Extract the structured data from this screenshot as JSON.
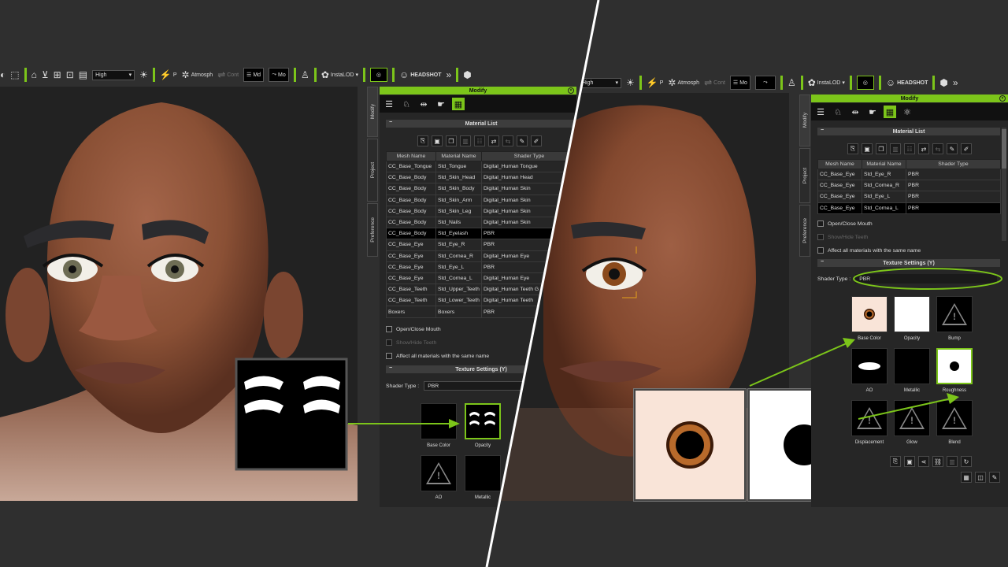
{
  "toolbar_left": {
    "render_quality": "High",
    "p_label": "P",
    "atmosphere_label": "Atmosph",
    "cont_label": "Cont",
    "md_label": "Md",
    "mo_label": "Mo",
    "instalod_label": "InstaLOD",
    "headshot_label": "HEADSHOT",
    "more": "»"
  },
  "toolbar_right": {
    "render_quality": "High",
    "p_label": "P",
    "atmosphere_label": "Atmosph",
    "cont_label": "Cont",
    "md_label": "Mo",
    "instalod_label": "InstaLOD",
    "headshot_label": "HEADSHOT",
    "more": "»"
  },
  "side_tabs": [
    "Modify",
    "Project",
    "Preference"
  ],
  "left_panel": {
    "title": "Modify",
    "material_list_title": "Material List",
    "columns": [
      "Mesh Name",
      "Material Name",
      "Shader Type"
    ],
    "rows": [
      [
        "CC_Base_Tongue",
        "Std_Tongue",
        "Digital_Human Tongue"
      ],
      [
        "CC_Base_Body",
        "Std_Skin_Head",
        "Digital_Human Head"
      ],
      [
        "CC_Base_Body",
        "Std_Skin_Body",
        "Digital_Human Skin"
      ],
      [
        "CC_Base_Body",
        "Std_Skin_Arm",
        "Digital_Human Skin"
      ],
      [
        "CC_Base_Body",
        "Std_Skin_Leg",
        "Digital_Human Skin"
      ],
      [
        "CC_Base_Body",
        "Std_Nails",
        "Digital_Human Skin"
      ],
      [
        "CC_Base_Body",
        "Std_Eyelash",
        "PBR"
      ],
      [
        "CC_Base_Eye",
        "Std_Eye_R",
        "PBR"
      ],
      [
        "CC_Base_Eye",
        "Std_Cornea_R",
        "Digital_Human Eye"
      ],
      [
        "CC_Base_Eye",
        "Std_Eye_L",
        "PBR"
      ],
      [
        "CC_Base_Eye",
        "Std_Cornea_L",
        "Digital_Human Eye"
      ],
      [
        "CC_Base_Teeth",
        "Std_Upper_Teeth",
        "Digital_Human Teeth G"
      ],
      [
        "CC_Base_Teeth",
        "Std_Lower_Teeth",
        "Digital_Human Teeth"
      ],
      [
        "Boxers",
        "Boxers",
        "PBR"
      ]
    ],
    "highlight_row": 6,
    "open_close_mouth": "Open/Close Mouth",
    "show_hide_teeth": "Show/Hide Teeth",
    "affect_all": "Affect all materials with the same name",
    "texture_settings_title": "Texture Settings  (Y)",
    "shader_type_label": "Shader Type :",
    "shader_type_value": "PBR",
    "textures": [
      "Base Color",
      "Opacity",
      "AO",
      "Metallic"
    ]
  },
  "right_panel": {
    "title": "Modify",
    "material_list_title": "Material List",
    "columns": [
      "Mesh Name",
      "Material Name",
      "Shader Type"
    ],
    "rows": [
      [
        "CC_Base_Eye",
        "Std_Eye_R",
        "PBR"
      ],
      [
        "CC_Base_Eye",
        "Std_Cornea_R",
        "PBR"
      ],
      [
        "CC_Base_Eye",
        "Std_Eye_L",
        "PBR"
      ],
      [
        "CC_Base_Eye",
        "Std_Cornea_L",
        "PBR"
      ]
    ],
    "highlight_row": 3,
    "open_close_mouth": "Open/Close Mouth",
    "show_hide_teeth": "Show/Hide Teeth",
    "affect_all": "Affect all materials with the same name",
    "texture_settings_title": "Texture Settings  (Y)",
    "shader_type_label": "Shader Type :",
    "shader_type_value": "PBR",
    "textures": [
      "Base Color",
      "Opacity",
      "Bump",
      "AO",
      "Metallic",
      "Roughness",
      "Displacement",
      "Glow",
      "Blend"
    ]
  },
  "colors": {
    "accent": "#7cc51a",
    "background": "#2f2f2f",
    "panel": "#262626",
    "viewport": "#222222",
    "skin": "#8a5035"
  },
  "icons": [
    "home-icon",
    "sun-icon",
    "settings-sliders-icon",
    "pose-figure-icon",
    "instalod-icon",
    "headshot-icon",
    "checker-icon",
    "warning-icon",
    "eyedropper-icon",
    "more-chevron-icon"
  ]
}
